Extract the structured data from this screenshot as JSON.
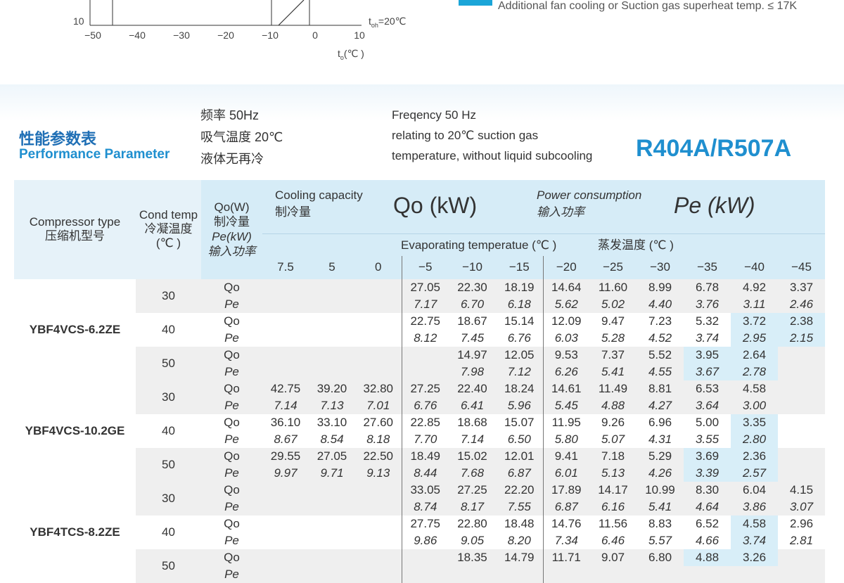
{
  "chart_fragment": {
    "x_ticks": [
      "−50",
      "−40",
      "−30",
      "−20",
      "−10",
      "0",
      "10"
    ],
    "y_tick": "10",
    "toh_label": "t",
    "toh_sub": "oh",
    "toh_value": "=20℃",
    "xlabel_t": "t",
    "xlabel_sub": "o",
    "xlabel_unit": "(℃ )",
    "legend_note": "Additional fan cooling  or Suction gas superheat temp. ≤ 17K",
    "colors": {
      "accent": "#1ba5d8"
    }
  },
  "header": {
    "title_cn": "性能参数表",
    "title_en": "Performance Parameter",
    "conditions_cn": [
      "频率 50Hz",
      "吸气温度 20℃",
      "液体无再冷"
    ],
    "conditions_en": [
      "Freqency 50 Hz",
      "relating to 20℃ suction gas",
      "temperature, without liquid subcooling"
    ],
    "refrigerant": "R404A/R507A"
  },
  "table": {
    "h_compressor_en": "Compressor type",
    "h_compressor_cn": "压缩机型号",
    "h_cond_en": "Cond temp",
    "h_cond_cn": "冷凝温度",
    "h_cond_unit": "(℃ )",
    "h_qo_en": "Qo(W)",
    "h_qo_cn": "制冷量",
    "h_pe_en": "Pe(kW)",
    "h_pe_cn": "输入功率",
    "h_cooling_en": "Cooling capacity",
    "h_cooling_cn": "制冷量",
    "h_qo_big": "Qo (kW)",
    "h_power_en": "Power consumption",
    "h_power_cn": "输入功率",
    "h_pe_big": "Pe (kW)",
    "h_evap_en": "Evaporating temperatue (℃ )",
    "h_evap_cn": "蒸发温度 (℃ )",
    "evap_temps": [
      "7.5",
      "5",
      "0",
      "−5",
      "−10",
      "−15",
      "−20",
      "−25",
      "−30",
      "−35",
      "−40",
      "−45"
    ],
    "label_qo": "Qo",
    "label_pe": "Pe",
    "models": [
      {
        "name": "YBF4VCS-6.2ZE",
        "rows": [
          {
            "cond": "30",
            "qo": [
              "",
              "",
              "",
              "27.05",
              "22.30",
              "18.19",
              "14.64",
              "11.60",
              "8.99",
              "6.78",
              "4.92",
              "3.37"
            ],
            "pe": [
              "",
              "",
              "",
              "7.17",
              "6.70",
              "6.18",
              "5.62",
              "5.02",
              "4.40",
              "3.76",
              "3.11",
              "2.46"
            ]
          },
          {
            "cond": "40",
            "qo": [
              "",
              "",
              "",
              "22.75",
              "18.67",
              "15.14",
              "12.09",
              "9.47",
              "7.23",
              "5.32",
              "3.72",
              "2.38"
            ],
            "pe": [
              "",
              "",
              "",
              "8.12",
              "7.45",
              "6.76",
              "6.03",
              "5.28",
              "4.52",
              "3.74",
              "2.95",
              "2.15"
            ]
          },
          {
            "cond": "50",
            "qo": [
              "",
              "",
              "",
              "",
              "14.97",
              "12.05",
              "9.53",
              "7.37",
              "5.52",
              "3.95",
              "2.64",
              ""
            ],
            "pe": [
              "",
              "",
              "",
              "",
              "7.98",
              "7.12",
              "6.26",
              "5.41",
              "4.55",
              "3.67",
              "2.78",
              ""
            ]
          }
        ]
      },
      {
        "name": "YBF4VCS-10.2GE",
        "rows": [
          {
            "cond": "30",
            "qo": [
              "42.75",
              "39.20",
              "32.80",
              "27.25",
              "22.40",
              "18.24",
              "14.61",
              "11.49",
              "8.81",
              "6.53",
              "4.58",
              ""
            ],
            "pe": [
              "7.14",
              "7.13",
              "7.01",
              "6.76",
              "6.41",
              "5.96",
              "5.45",
              "4.88",
              "4.27",
              "3.64",
              "3.00",
              ""
            ]
          },
          {
            "cond": "40",
            "qo": [
              "36.10",
              "33.10",
              "27.60",
              "22.85",
              "18.68",
              "15.07",
              "11.95",
              "9.26",
              "6.96",
              "5.00",
              "3.35",
              ""
            ],
            "pe": [
              "8.67",
              "8.54",
              "8.18",
              "7.70",
              "7.14",
              "6.50",
              "5.80",
              "5.07",
              "4.31",
              "3.55",
              "2.80",
              ""
            ]
          },
          {
            "cond": "50",
            "qo": [
              "29.55",
              "27.05",
              "22.50",
              "18.49",
              "15.02",
              "12.01",
              "9.41",
              "7.18",
              "5.29",
              "3.69",
              "2.36",
              ""
            ],
            "pe": [
              "9.97",
              "9.71",
              "9.13",
              "8.44",
              "7.68",
              "6.87",
              "6.01",
              "5.13",
              "4.26",
              "3.39",
              "2.57",
              ""
            ]
          }
        ]
      },
      {
        "name": "YBF4TCS-8.2ZE",
        "rows": [
          {
            "cond": "30",
            "qo": [
              "",
              "",
              "",
              "33.05",
              "27.25",
              "22.20",
              "17.89",
              "14.17",
              "10.99",
              "8.30",
              "6.04",
              "4.15"
            ],
            "pe": [
              "",
              "",
              "",
              "8.74",
              "8.17",
              "7.55",
              "6.87",
              "6.16",
              "5.41",
              "4.64",
              "3.86",
              "3.07"
            ]
          },
          {
            "cond": "40",
            "qo": [
              "",
              "",
              "",
              "27.75",
              "22.80",
              "18.48",
              "14.76",
              "11.56",
              "8.83",
              "6.52",
              "4.58",
              "2.96"
            ],
            "pe": [
              "",
              "",
              "",
              "9.86",
              "9.05",
              "8.20",
              "7.34",
              "6.46",
              "5.57",
              "4.66",
              "3.74",
              "2.81"
            ]
          },
          {
            "cond": "50",
            "qo": [
              "",
              "",
              "",
              "",
              "18.35",
              "14.79",
              "11.71",
              "9.07",
              "6.80",
              "4.88",
              "3.26",
              ""
            ],
            "pe": [
              "",
              "",
              "",
              "",
              "",
              "",
              "",
              "",
              "",
              "",
              "",
              ""
            ]
          }
        ]
      }
    ],
    "highlight_cells": [
      [
        0,
        1,
        "qo",
        10
      ],
      [
        0,
        1,
        "qo",
        11
      ],
      [
        0,
        1,
        "pe",
        10
      ],
      [
        0,
        1,
        "pe",
        11
      ],
      [
        0,
        2,
        "qo",
        9
      ],
      [
        0,
        2,
        "qo",
        10
      ],
      [
        0,
        2,
        "pe",
        9
      ],
      [
        0,
        2,
        "pe",
        10
      ],
      [
        1,
        1,
        "qo",
        10
      ],
      [
        1,
        1,
        "pe",
        10
      ],
      [
        1,
        2,
        "qo",
        9
      ],
      [
        1,
        2,
        "qo",
        10
      ],
      [
        1,
        2,
        "pe",
        9
      ],
      [
        1,
        2,
        "pe",
        10
      ],
      [
        2,
        1,
        "qo",
        10
      ],
      [
        2,
        1,
        "pe",
        10
      ],
      [
        2,
        2,
        "qo",
        9
      ],
      [
        2,
        2,
        "qo",
        10
      ]
    ],
    "colors": {
      "header_bg": "#d6ecf7",
      "highlight": "#d8eef8",
      "grey_band": "#efefef"
    }
  }
}
